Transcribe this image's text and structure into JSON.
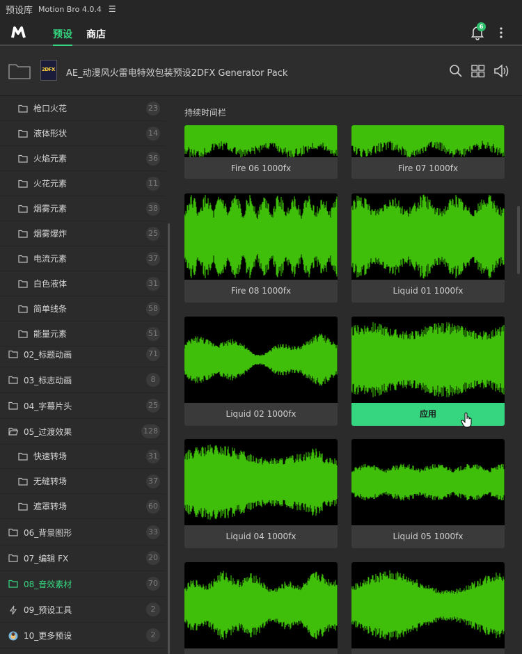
{
  "titlebar": {
    "app": "预设库",
    "version": "Motion Bro 4.0.4"
  },
  "nav": {
    "tabs": [
      "预设",
      "商店"
    ],
    "notification_count": "6",
    "accent": "#35d67f"
  },
  "pack": {
    "title": "AE_动漫风火雷电特效包装预设2DFX Generator Pack",
    "thumb_text": "2DFX"
  },
  "sidebar": {
    "items": [
      {
        "label": "枪口火花",
        "count": "23",
        "level": "sub"
      },
      {
        "label": "液体形状",
        "count": "14",
        "level": "sub"
      },
      {
        "label": "火焰元素",
        "count": "36",
        "level": "sub"
      },
      {
        "label": "火花元素",
        "count": "11",
        "level": "sub"
      },
      {
        "label": "烟雾元素",
        "count": "38",
        "level": "sub"
      },
      {
        "label": "烟雾爆炸",
        "count": "25",
        "level": "sub"
      },
      {
        "label": "电流元素",
        "count": "37",
        "level": "sub"
      },
      {
        "label": "白色液体",
        "count": "31",
        "level": "sub"
      },
      {
        "label": "简单线条",
        "count": "58",
        "level": "sub"
      },
      {
        "label": "能量元素",
        "count": "51",
        "level": "sub"
      },
      {
        "label": "02_标题动画",
        "count": "71",
        "level": "top"
      },
      {
        "label": "03_标志动画",
        "count": "8",
        "level": "top"
      },
      {
        "label": "04_字幕片头",
        "count": "25",
        "level": "top"
      },
      {
        "label": "05_过渡效果",
        "count": "128",
        "level": "top-open"
      },
      {
        "label": "快速转场",
        "count": "31",
        "level": "sub"
      },
      {
        "label": "无缝转场",
        "count": "37",
        "level": "sub"
      },
      {
        "label": "遮罩转场",
        "count": "60",
        "level": "sub"
      },
      {
        "label": "06_背景图形",
        "count": "33",
        "level": "top"
      },
      {
        "label": "07_编辑 FX",
        "count": "20",
        "level": "top"
      },
      {
        "label": "08_音效素材",
        "count": "70",
        "level": "top-selected"
      },
      {
        "label": "09_预设工具",
        "count": "2",
        "level": "top-bolt"
      },
      {
        "label": "10_更多预设",
        "count": "2",
        "level": "top-avatar"
      }
    ]
  },
  "content": {
    "section_label": "持续时间栏",
    "cards": [
      {
        "label": "Fire 06 1000fx"
      },
      {
        "label": "Fire 07 1000fx"
      },
      {
        "label": "Fire 08 1000fx"
      },
      {
        "label": "Liquid 01 1000fx"
      },
      {
        "label": "Liquid 02 1000fx"
      },
      {
        "label": "应用"
      },
      {
        "label": "Liquid 04 1000fx"
      },
      {
        "label": "Liquid 05 1000fx"
      },
      {
        "label": ""
      },
      {
        "label": ""
      }
    ],
    "wave_color": "#3fbf0a"
  }
}
